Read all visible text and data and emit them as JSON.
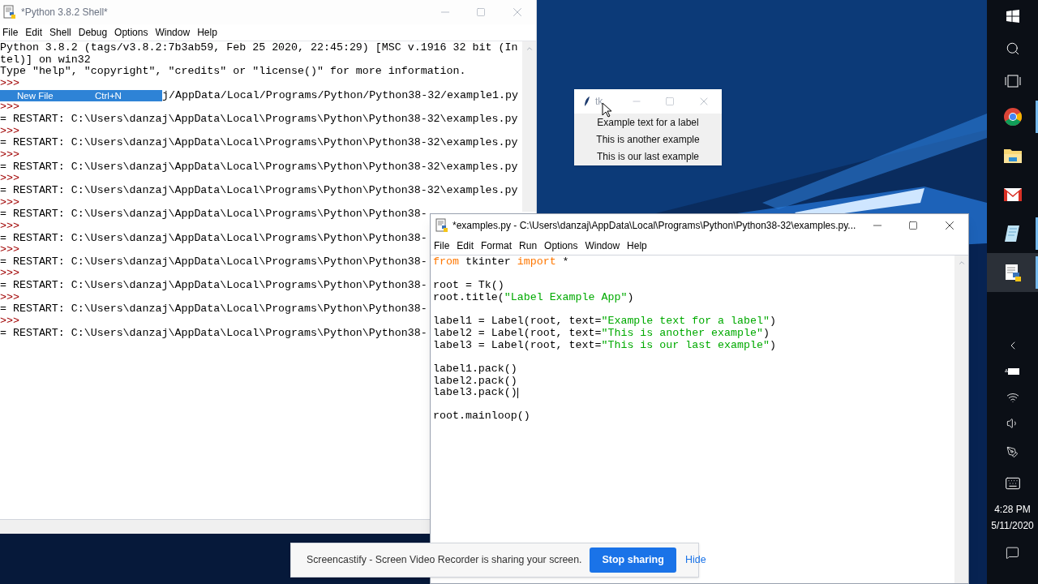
{
  "shell": {
    "title": "*Python 3.8.2 Shell*",
    "active": false,
    "menu": [
      "File",
      "Edit",
      "Shell",
      "Debug",
      "Options",
      "Window",
      "Help"
    ],
    "lines": [
      {
        "kind": "output",
        "text": "Python 3.8.2 (tags/v3.8.2:7b3ab59, Feb 25 2020, 22:45:29) [MSC v.1916 32 bit (In"
      },
      {
        "kind": "output",
        "text": "tel)] on win32"
      },
      {
        "kind": "output",
        "text": "Type \"help\", \"copyright\", \"credits\" or \"license()\" for more information."
      },
      {
        "kind": "prompt",
        "text": ">>>"
      },
      {
        "kind": "popup",
        "label": "New File",
        "shortcut": "Ctrl+N",
        "selected": true,
        "text": "j/AppData/Local/Programs/Python/Python38-32/example1.py"
      },
      {
        "kind": "prompt",
        "text": ">>>"
      },
      {
        "kind": "output",
        "text": "= RESTART: C:\\Users\\danzaj\\AppData\\Local\\Programs\\Python\\Python38-32\\examples.py"
      },
      {
        "kind": "prompt",
        "text": ">>>"
      },
      {
        "kind": "output",
        "text": "= RESTART: C:\\Users\\danzaj\\AppData\\Local\\Programs\\Python\\Python38-32\\examples.py"
      },
      {
        "kind": "prompt",
        "text": ">>>"
      },
      {
        "kind": "output",
        "text": "= RESTART: C:\\Users\\danzaj\\AppData\\Local\\Programs\\Python\\Python38-32\\examples.py"
      },
      {
        "kind": "prompt",
        "text": ">>>"
      },
      {
        "kind": "output",
        "text": "= RESTART: C:\\Users\\danzaj\\AppData\\Local\\Programs\\Python\\Python38-32\\examples.py"
      },
      {
        "kind": "prompt",
        "text": ">>>"
      },
      {
        "kind": "output",
        "text": "= RESTART: C:\\Users\\danzaj\\AppData\\Local\\Programs\\Python\\Python38-"
      },
      {
        "kind": "prompt",
        "text": ">>>"
      },
      {
        "kind": "output",
        "text": "= RESTART: C:\\Users\\danzaj\\AppData\\Local\\Programs\\Python\\Python38-"
      },
      {
        "kind": "prompt",
        "text": ">>>"
      },
      {
        "kind": "output",
        "text": "= RESTART: C:\\Users\\danzaj\\AppData\\Local\\Programs\\Python\\Python38-"
      },
      {
        "kind": "prompt",
        "text": ">>>"
      },
      {
        "kind": "output",
        "text": "= RESTART: C:\\Users\\danzaj\\AppData\\Local\\Programs\\Python\\Python38-"
      },
      {
        "kind": "prompt",
        "text": ">>>"
      },
      {
        "kind": "output",
        "text": "= RESTART: C:\\Users\\danzaj\\AppData\\Local\\Programs\\Python\\Python38-"
      },
      {
        "kind": "prompt",
        "text": ">>>"
      },
      {
        "kind": "output",
        "text": "= RESTART: C:\\Users\\danzaj\\AppData\\Local\\Programs\\Python\\Python38-"
      }
    ]
  },
  "tk_window": {
    "title": "tk",
    "labels": [
      "Example text for a label",
      "This is another example",
      "This is our last example"
    ]
  },
  "editor": {
    "title": "*examples.py - C:\\Users\\danzaj\\AppData\\Local\\Programs\\Python\\Python38-32\\examples.py...",
    "active": true,
    "menu": [
      "File",
      "Edit",
      "Format",
      "Run",
      "Options",
      "Window",
      "Help"
    ],
    "lines": [
      {
        "kind": "code",
        "tokens": [
          {
            "kind": "keyword",
            "text": "from"
          },
          {
            "kind": "plain",
            "text": " tkinter "
          },
          {
            "kind": "keyword",
            "text": "import"
          },
          {
            "kind": "plain",
            "text": " *"
          }
        ]
      },
      {
        "kind": "blank"
      },
      {
        "kind": "code",
        "tokens": [
          {
            "kind": "plain",
            "text": "root = Tk()"
          }
        ]
      },
      {
        "kind": "code",
        "tokens": [
          {
            "kind": "plain",
            "text": "root.title("
          },
          {
            "kind": "string",
            "text": "\"Label Example App\""
          },
          {
            "kind": "plain",
            "text": ")"
          }
        ]
      },
      {
        "kind": "blank"
      },
      {
        "kind": "code",
        "tokens": [
          {
            "kind": "plain",
            "text": "label1 = Label(root, text="
          },
          {
            "kind": "string",
            "text": "\"Example text for a label\""
          },
          {
            "kind": "plain",
            "text": ")"
          }
        ]
      },
      {
        "kind": "code",
        "tokens": [
          {
            "kind": "plain",
            "text": "label2 = Label(root, text="
          },
          {
            "kind": "string",
            "text": "\"This is another example\""
          },
          {
            "kind": "plain",
            "text": ")"
          }
        ]
      },
      {
        "kind": "code",
        "tokens": [
          {
            "kind": "plain",
            "text": "label3 = Label(root, text="
          },
          {
            "kind": "string",
            "text": "\"This is our last example\""
          },
          {
            "kind": "plain",
            "text": ")"
          }
        ]
      },
      {
        "kind": "blank"
      },
      {
        "kind": "code",
        "tokens": [
          {
            "kind": "plain",
            "text": "label1.pack()"
          }
        ]
      },
      {
        "kind": "code",
        "tokens": [
          {
            "kind": "plain",
            "text": "label2.pack()"
          }
        ]
      },
      {
        "kind": "code",
        "tokens": [
          {
            "kind": "plain",
            "text": "label3.pack()"
          }
        ],
        "cursor": true
      },
      {
        "kind": "blank"
      },
      {
        "kind": "code",
        "tokens": [
          {
            "kind": "plain",
            "text": "root.mainloop()"
          }
        ]
      }
    ]
  },
  "taskbar": {
    "apps": [
      {
        "kind": "chrome",
        "running": true,
        "selected": false
      },
      {
        "kind": "folder",
        "running": false,
        "selected": false
      },
      {
        "kind": "mail",
        "running": false,
        "selected": false
      },
      {
        "kind": "notepad",
        "running": true,
        "selected": false
      },
      {
        "kind": "python",
        "running": true,
        "selected": true
      }
    ],
    "time": "4:28 PM",
    "date": "5/11/2020"
  },
  "share_bar": {
    "message": "Screencastify - Screen Video Recorder is sharing your screen.",
    "stop_button": "Stop sharing",
    "hide_link": "Hide"
  }
}
